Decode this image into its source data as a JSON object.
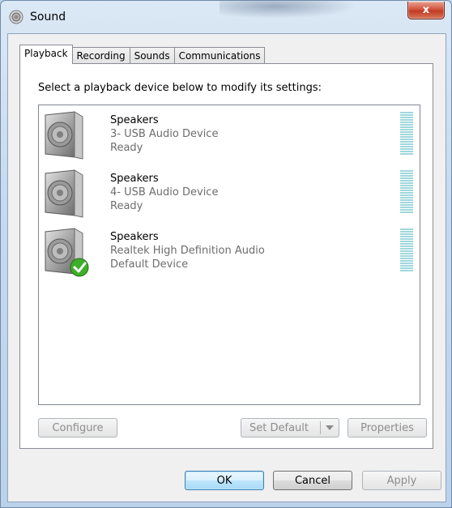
{
  "window": {
    "title": "Sound",
    "close_label": "x"
  },
  "tabs": [
    {
      "label": "Playback",
      "active": true
    },
    {
      "label": "Recording",
      "active": false
    },
    {
      "label": "Sounds",
      "active": false
    },
    {
      "label": "Communications",
      "active": false
    }
  ],
  "playback": {
    "instruction": "Select a playback device below to modify its settings:",
    "devices": [
      {
        "name": "Speakers",
        "description": "3- USB Audio Device",
        "status": "Ready",
        "is_default": false
      },
      {
        "name": "Speakers",
        "description": "4- USB Audio Device",
        "status": "Ready",
        "is_default": false
      },
      {
        "name": "Speakers",
        "description": "Realtek High Definition Audio",
        "status": "Default Device",
        "is_default": true
      }
    ],
    "buttons": {
      "configure": "Configure",
      "set_default": "Set Default",
      "properties": "Properties"
    }
  },
  "footer": {
    "ok": "OK",
    "cancel": "Cancel",
    "apply": "Apply"
  },
  "colors": {
    "level_meter": "#9fd8dc",
    "default_check": "#3fae2a",
    "close_button": "#c13b22"
  },
  "icons": {
    "window": "speaker-icon",
    "device": "speaker-icon",
    "default_badge": "green-check-icon"
  }
}
